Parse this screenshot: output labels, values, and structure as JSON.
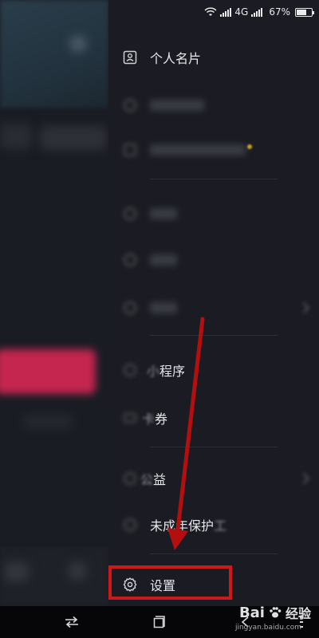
{
  "status_bar": {
    "network": "4G",
    "battery": "67%",
    "battery_level": 0.67
  },
  "drawer": {
    "items": [
      {
        "id": "card",
        "label": "个人名片",
        "icon": "id-card-icon"
      },
      {
        "id": "program",
        "label": "程序",
        "icon": "mini-program-icon",
        "partial_prefix": "小"
      },
      {
        "id": "coupon",
        "label": "券",
        "icon": "coupon-icon",
        "partial_prefix": "卡"
      },
      {
        "id": "charity",
        "label": "益",
        "icon": "charity-icon",
        "partial_prefix": "公"
      },
      {
        "id": "minor",
        "label": "未成年保护",
        "suffix": "工",
        "icon": "minor-protection-icon"
      },
      {
        "id": "settings",
        "label": "设置",
        "icon": "gear-icon"
      }
    ]
  },
  "annotation": {
    "highlight_color": "#d01818",
    "arrow_color": "#b30f0f"
  },
  "watermark": {
    "brand": "Bai",
    "brand_cn": "经验",
    "url": "jingyan.baidu.com"
  }
}
